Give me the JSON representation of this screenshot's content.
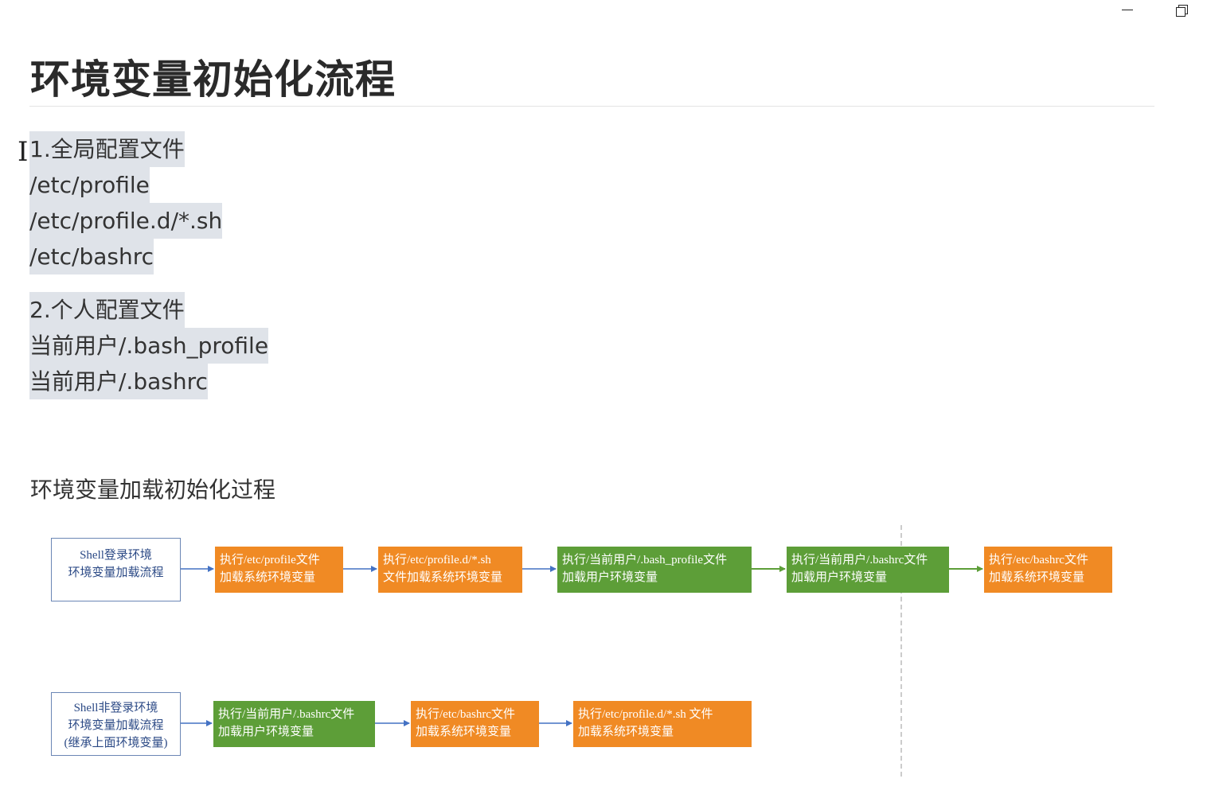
{
  "page": {
    "title": "环境变量初始化流程"
  },
  "global_config": {
    "heading": "1.全局配置文件",
    "items": [
      "/etc/profile",
      "/etc/profile.d/*.sh",
      "/etc/bashrc"
    ]
  },
  "personal_config": {
    "heading": "2.个人配置文件",
    "items": [
      "当前用户/.bash_profile",
      "当前用户/.bashrc"
    ]
  },
  "flow_section": {
    "heading": "环境变量加载初始化过程"
  },
  "login_flow": {
    "start": [
      "Shell登录环境",
      "环境变量加载流程"
    ],
    "steps": [
      {
        "lines": [
          "执行/etc/profile文件",
          "加载系统环境变量"
        ],
        "color": "orange"
      },
      {
        "lines": [
          "执行/etc/profile.d/*.sh",
          "文件加载系统环境变量"
        ],
        "color": "orange"
      },
      {
        "lines": [
          "执行/当前用户/.bash_profile文件",
          "加载用户环境变量"
        ],
        "color": "green"
      },
      {
        "lines": [
          "执行/当前用户/.bashrc文件",
          "加载用户环境变量"
        ],
        "color": "green"
      },
      {
        "lines": [
          "执行/etc/bashrc文件",
          "加载系统环境变量"
        ],
        "color": "orange"
      }
    ]
  },
  "nonlogin_flow": {
    "start": [
      "Shell非登录环境",
      "环境变量加载流程",
      "(继承上面环境变量)"
    ],
    "steps": [
      {
        "lines": [
          "执行/当前用户/.bashrc文件",
          "加载用户环境变量"
        ],
        "color": "green"
      },
      {
        "lines": [
          "执行/etc/bashrc文件",
          "加载系统环境变量"
        ],
        "color": "orange"
      },
      {
        "lines": [
          "执行/etc/profile.d/*.sh 文件",
          "加载系统环境变量"
        ],
        "color": "orange"
      }
    ]
  },
  "colors": {
    "orange": "#f08a24",
    "green": "#5d9e38",
    "start_border": "#6b86b5",
    "start_text": "#2c4a86",
    "arrow_blue": "#4472c4",
    "arrow_green": "#5d9e38",
    "selection": "#dfe3e9"
  }
}
